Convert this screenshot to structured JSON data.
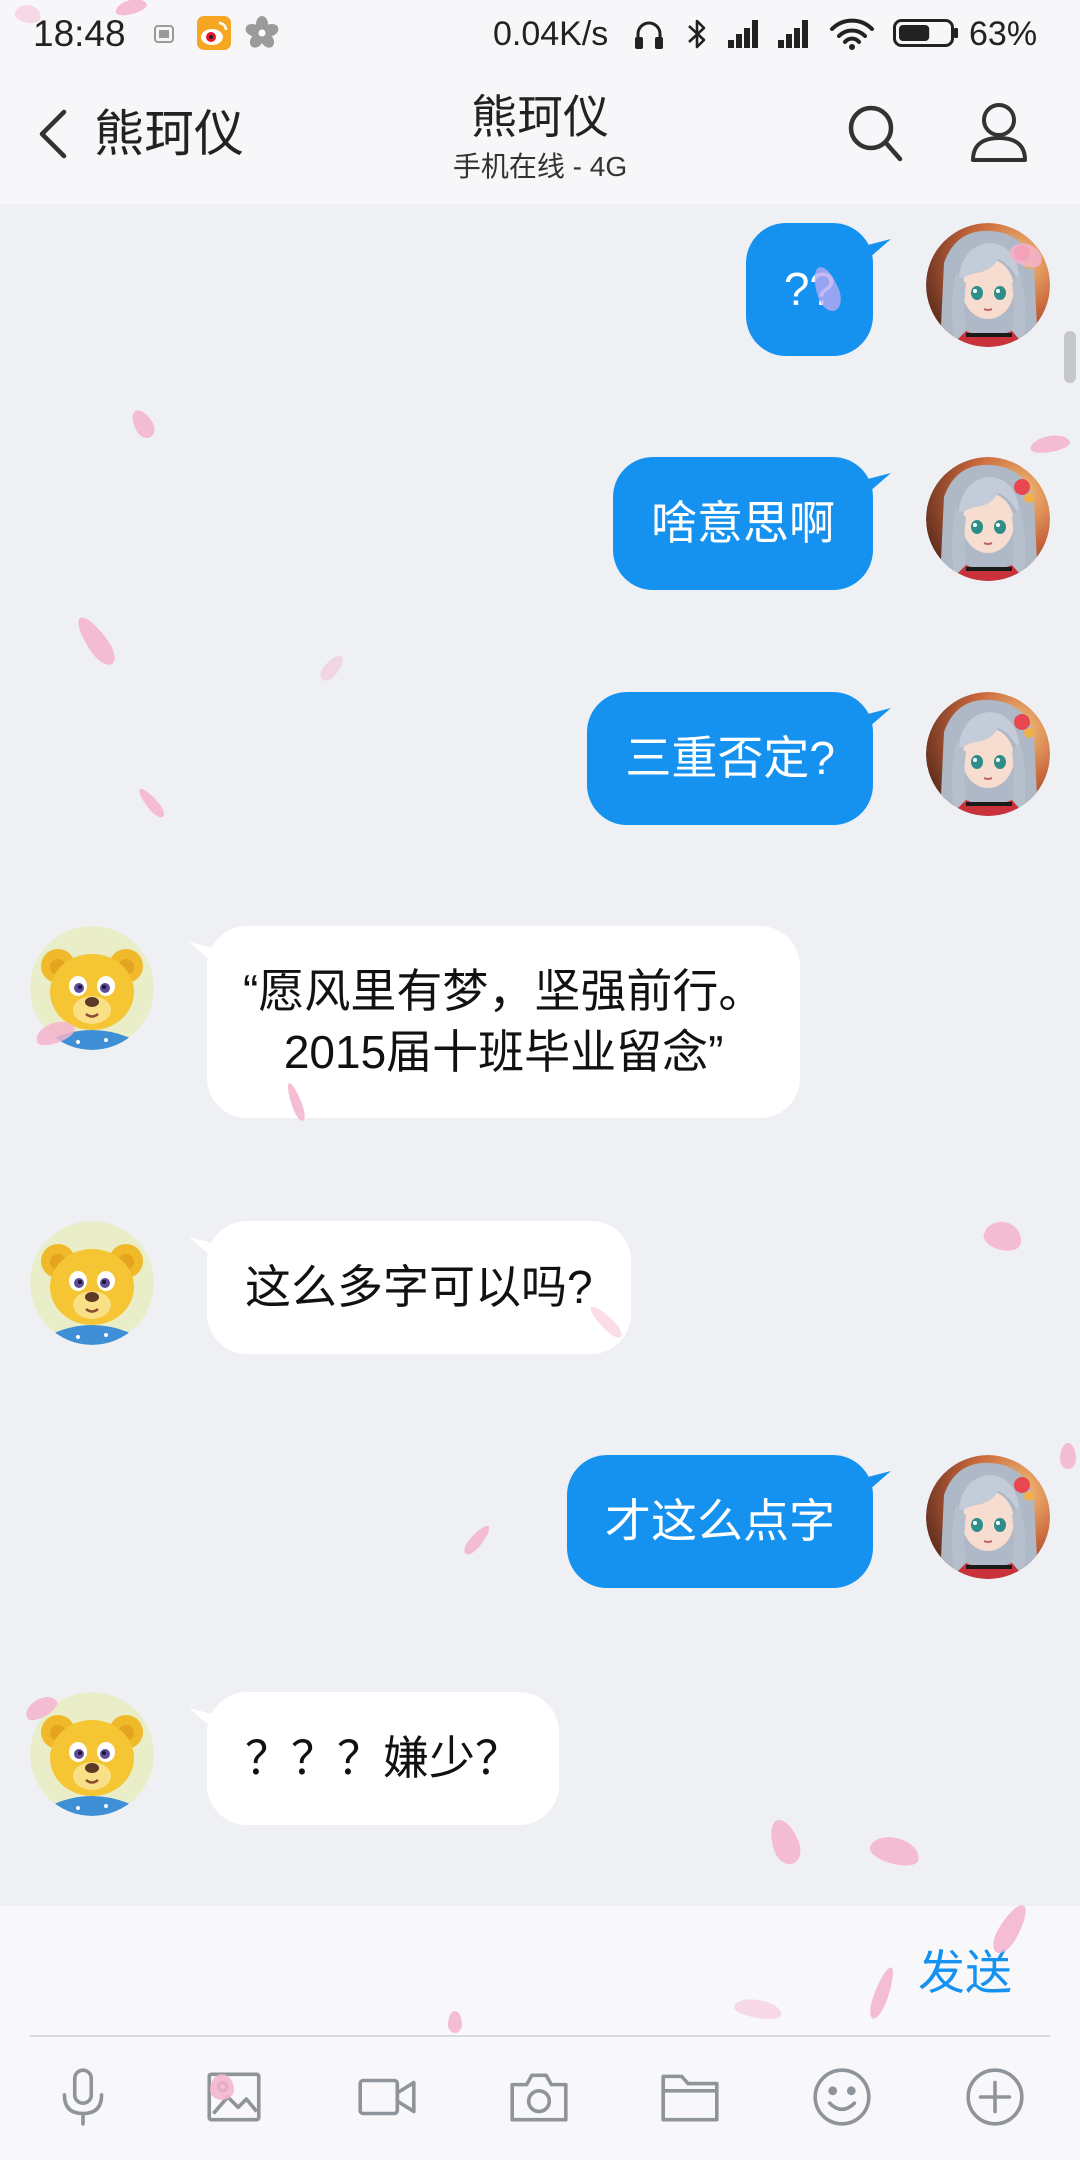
{
  "status_bar": {
    "time": "18:48",
    "net_speed": "0.04K/s",
    "battery_text": "63%",
    "battery_level": 0.63,
    "left_icons": [
      "notification-icon",
      "weibo-icon",
      "flower-icon"
    ],
    "right_icons": [
      "headphone-icon",
      "bluetooth-icon",
      "signal-icon",
      "signal-icon",
      "wifi-icon",
      "battery-icon"
    ]
  },
  "header": {
    "back_label": "熊珂仪",
    "title": "熊珂仪",
    "subtitle": "手机在线 - 4G",
    "actions": [
      "search-icon",
      "profile-icon"
    ]
  },
  "messages": [
    {
      "outgoing": true,
      "text": "??"
    },
    {
      "outgoing": true,
      "text": "啥意思啊"
    },
    {
      "outgoing": true,
      "text": "三重否定?"
    },
    {
      "outgoing": false,
      "lines": [
        "“愿风里有梦，坚强前行。",
        "2015届十班毕业留念”"
      ]
    },
    {
      "outgoing": false,
      "text": "这么多字可以吗?"
    },
    {
      "outgoing": true,
      "text": "才这么点字"
    },
    {
      "outgoing": false,
      "text": "？？？嫌少？"
    }
  ],
  "composer": {
    "input_value": "",
    "send_label": "发送"
  },
  "toolbar": {
    "icons": [
      "microphone-icon",
      "image-icon",
      "video-icon",
      "camera-icon",
      "folder-icon",
      "emoji-icon",
      "plus-icon"
    ]
  },
  "colors": {
    "accent": "#1592f0",
    "outgoing_bubble": "#1592f0",
    "incoming_bubble": "#ffffff",
    "chat_background": "#eff0f4",
    "header_background": "#f7f7f9",
    "icon_gray": "#8f949b",
    "petal": "#f5b3cc"
  }
}
